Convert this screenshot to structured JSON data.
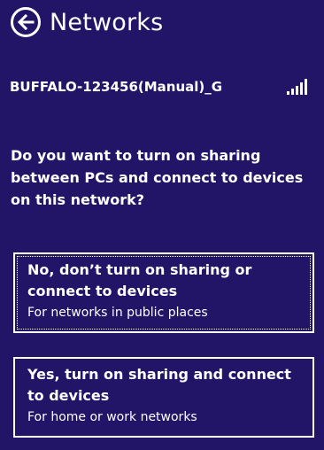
{
  "header": {
    "title": "Networks",
    "back_icon": "back-arrow-circle-icon"
  },
  "network": {
    "name": "BUFFALO-123456(Manual)_G",
    "signal_icon": "signal-strength-icon",
    "signal_bars": 5
  },
  "prompt": {
    "question": "Do you want to turn on sharing between PCs and connect to devices on this network?"
  },
  "options": [
    {
      "title": "No, don’t turn on sharing or connect to devices",
      "subtitle": "For networks in public places"
    },
    {
      "title": "Yes, turn on sharing and connect to devices",
      "subtitle": "For home or work networks"
    }
  ],
  "colors": {
    "background": "#221466",
    "foreground": "#ffffff"
  }
}
